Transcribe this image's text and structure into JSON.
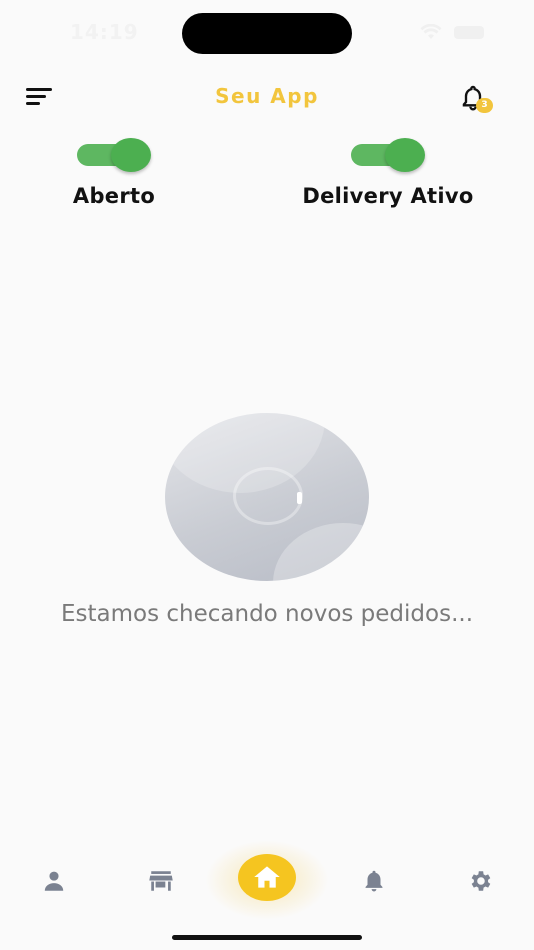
{
  "status_bar": {
    "time": "14:19"
  },
  "header": {
    "title": "Seu App",
    "notification_count": "3",
    "menu_icon": "hamburger-menu-icon",
    "bell_icon": "bell-icon"
  },
  "toggles": {
    "open": {
      "label": "Aberto",
      "state": "on"
    },
    "delivery": {
      "label": "Delivery Ativo",
      "state": "on"
    }
  },
  "main": {
    "checking_text": "Estamos checando novos pedidos..."
  },
  "bottom_nav": {
    "items": [
      {
        "icon": "person-icon",
        "active": false
      },
      {
        "icon": "store-icon",
        "active": false
      },
      {
        "icon": "home-icon",
        "active": true
      },
      {
        "icon": "bell-icon",
        "active": false
      },
      {
        "icon": "gear-icon",
        "active": false
      }
    ]
  },
  "colors": {
    "accent": "#f2c53d",
    "toggle_on": "#4caf50",
    "nav_icon": "#7b8291",
    "background": "#fafafa"
  }
}
